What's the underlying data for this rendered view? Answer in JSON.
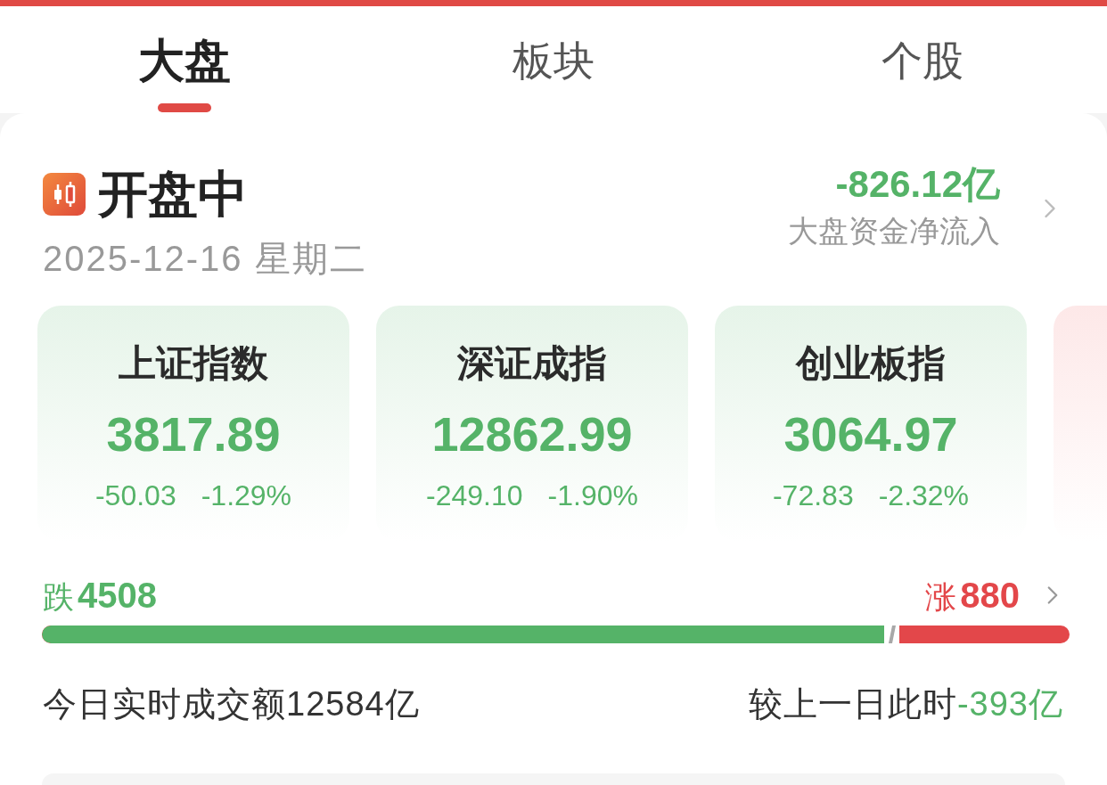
{
  "tabs": [
    {
      "label": "大盘",
      "selected": true
    },
    {
      "label": "板块",
      "selected": false
    },
    {
      "label": "个股",
      "selected": false
    }
  ],
  "market": {
    "status": "开盘中",
    "date": "2025-12-16 星期二",
    "net_inflow": "-826.12亿",
    "net_inflow_label": "大盘资金净流入"
  },
  "indices": [
    {
      "name": "上证指数",
      "value": "3817.89",
      "change": "-50.03",
      "percent": "-1.29%",
      "rising": false
    },
    {
      "name": "深证成指",
      "value": "12862.99",
      "change": "-249.10",
      "percent": "-1.90%",
      "rising": false
    },
    {
      "name": "创业板指",
      "value": "3064.97",
      "change": "-72.83",
      "percent": "-2.32%",
      "rising": false
    },
    {
      "rising": true
    }
  ],
  "breadth": {
    "fall_label": "跌",
    "fall_count": "4508",
    "rise_label": "涨",
    "rise_count": "880",
    "level": 0.82
  },
  "turnover": {
    "label": "今日实时成交额12584亿",
    "compare_label": "较上一日此时",
    "compare_value": "-393亿"
  }
}
